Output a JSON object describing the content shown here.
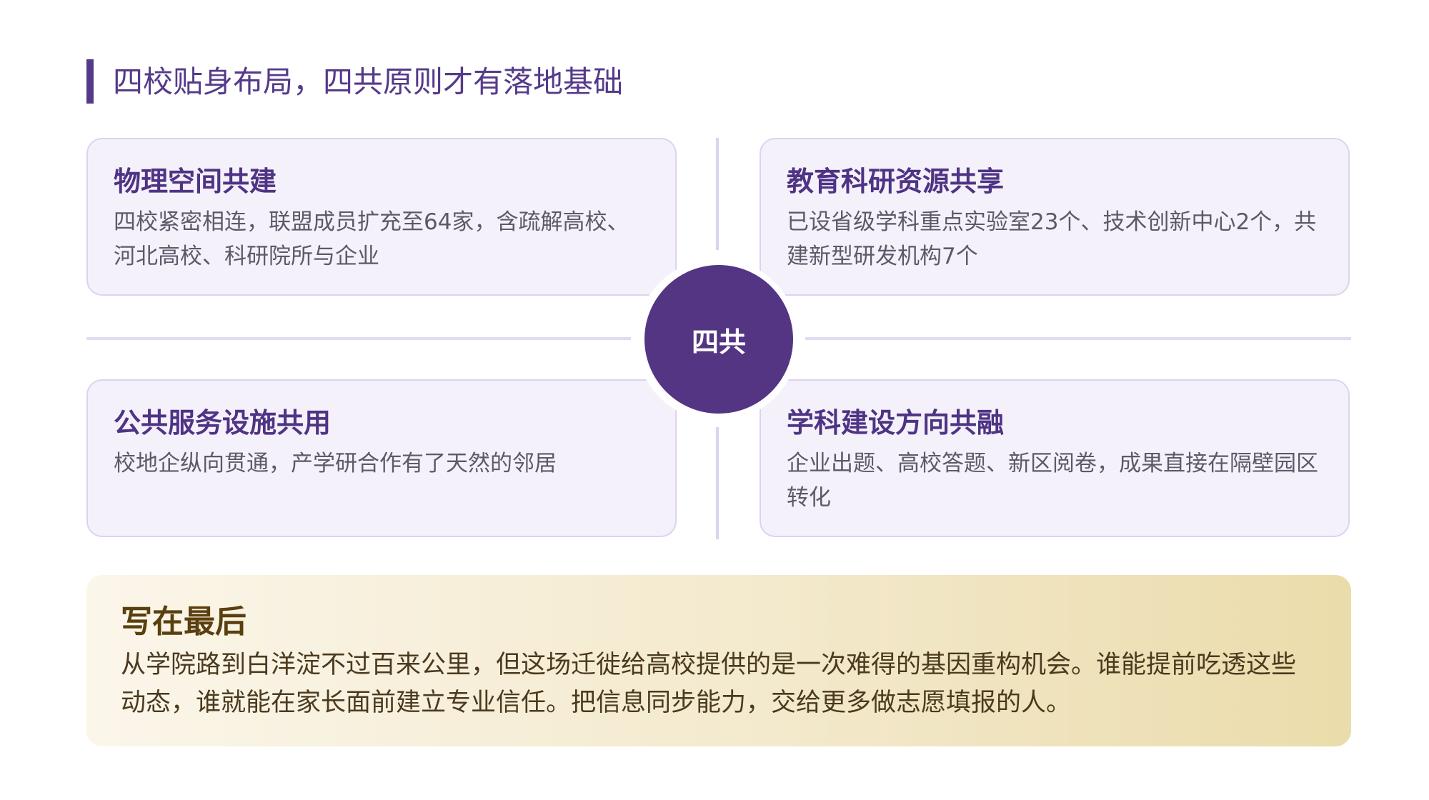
{
  "page": {
    "title": "四校贴身布局，四共原则才有落地基础"
  },
  "center": {
    "label": "四共"
  },
  "cards": [
    {
      "title": "物理空间共建",
      "body": "四校紧密相连，联盟成员扩充至64家，含疏解高校、河北高校、科研院所与企业"
    },
    {
      "title": "教育科研资源共享",
      "body": "已设省级学科重点实验室23个、技术创新中心2个，共建新型研发机构7个"
    },
    {
      "title": "公共服务设施共用",
      "body": "校地企纵向贯通，产学研合作有了天然的邻居"
    },
    {
      "title": "学科建设方向共融",
      "body": "企业出题、高校答题、新区阅卷，成果直接在隔壁园区转化"
    }
  ],
  "final": {
    "title": "写在最后",
    "body": "从学院路到白洋淀不过百来公里，但这场迁徙给高校提供的是一次难得的基因重构机会。谁能提前吃透这些动态，谁就能在家长面前建立专业信任。把信息同步能力，交给更多做志愿填报的人。"
  },
  "colors": {
    "accent": "#553a8a",
    "card_bg": "#f4f1fb",
    "card_border": "#dcd3f0",
    "final_bg_start": "#fbf6ea",
    "final_bg_end": "#ebdcab"
  }
}
